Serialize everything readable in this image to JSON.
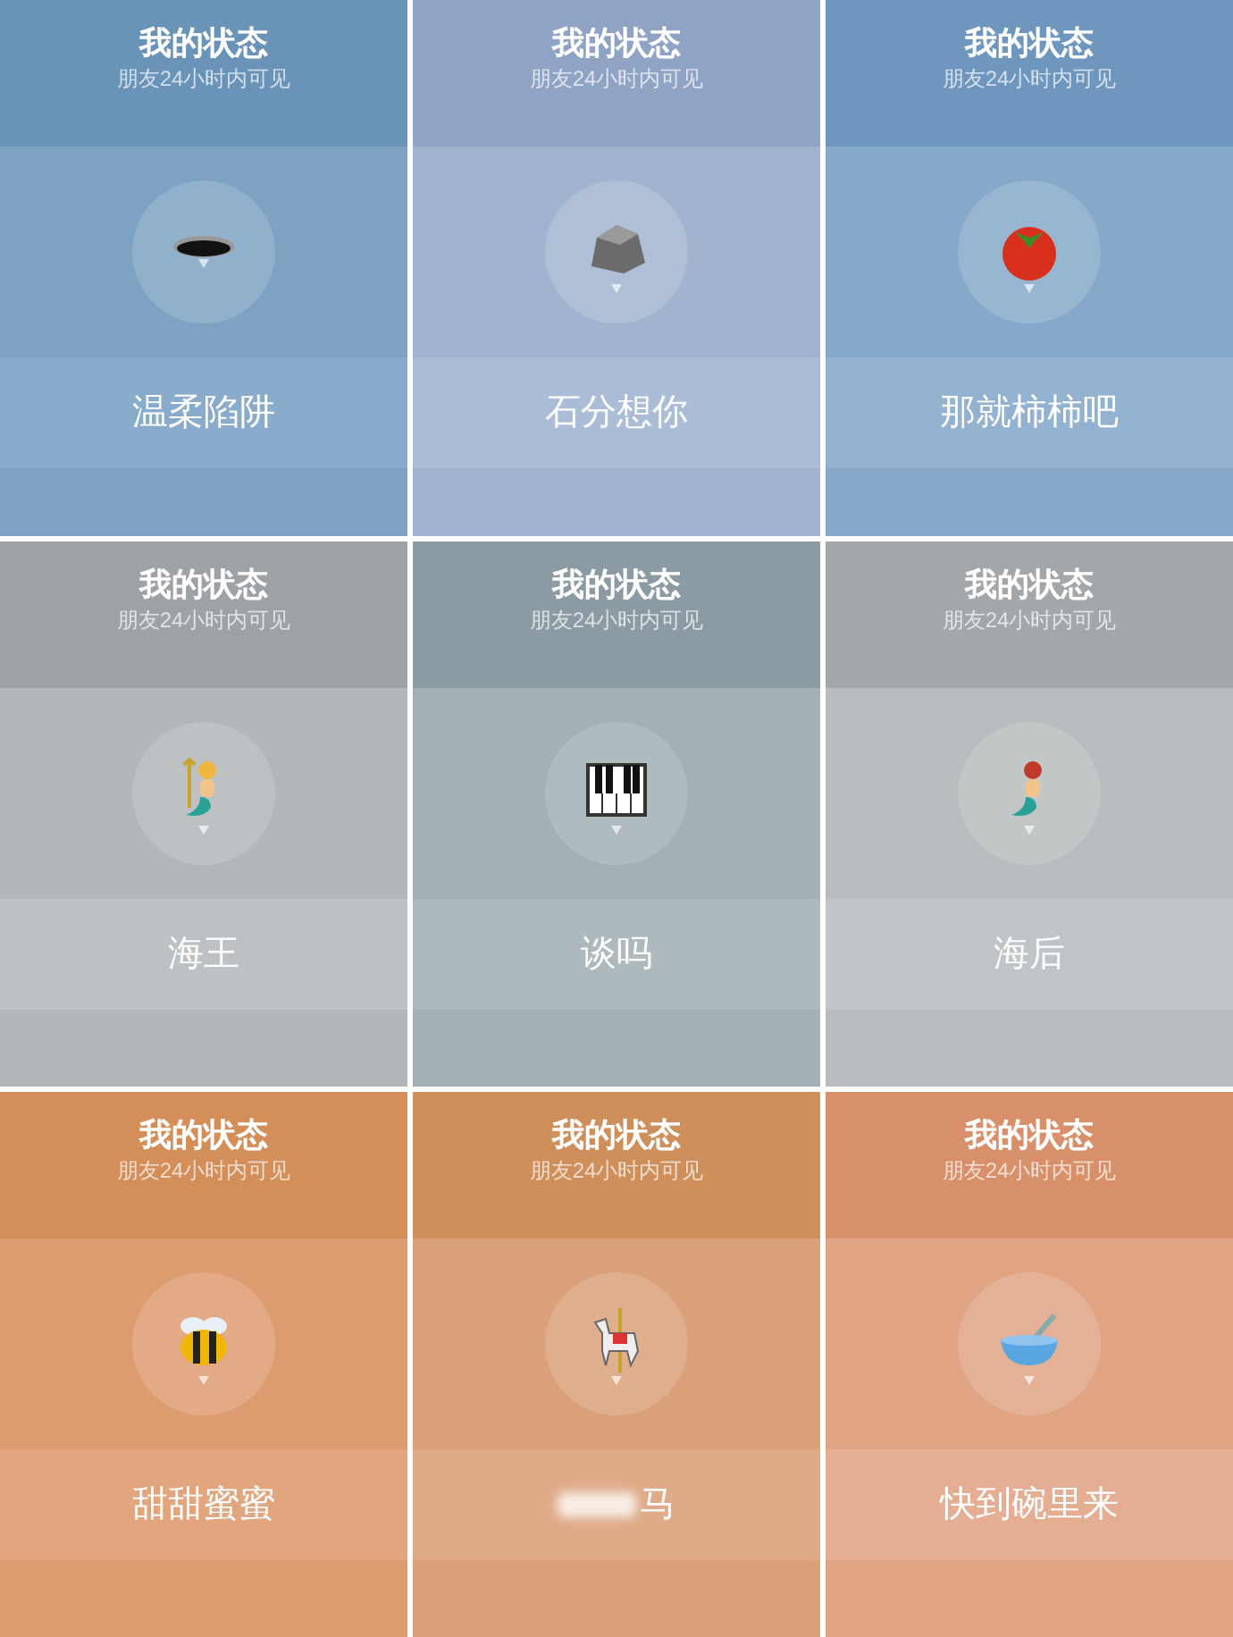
{
  "tiles": [
    {
      "title": "我的状态",
      "subtitle": "朋友24小时内可见",
      "kind": "hole",
      "status": "温柔陷阱"
    },
    {
      "title": "我的状态",
      "subtitle": "朋友24小时内可见",
      "kind": "rock",
      "status": "石分想你"
    },
    {
      "title": "我的状态",
      "subtitle": "朋友24小时内可见",
      "kind": "tomato",
      "status": "那就柿柿吧"
    },
    {
      "title": "我的状态",
      "subtitle": "朋友24小时内可见",
      "kind": "merman",
      "status": "海王"
    },
    {
      "title": "我的状态",
      "subtitle": "朋友24小时内可见",
      "kind": "piano",
      "status": "谈吗"
    },
    {
      "title": "我的状态",
      "subtitle": "朋友24小时内可见",
      "kind": "mermaid",
      "status": "海后"
    },
    {
      "title": "我的状态",
      "subtitle": "朋友24小时内可见",
      "kind": "bee",
      "status": "甜甜蜜蜜"
    },
    {
      "title": "我的状态",
      "subtitle": "朋友24小时内可见",
      "kind": "horse",
      "status": "马",
      "blurred": true
    },
    {
      "title": "我的状态",
      "subtitle": "朋友24小时内可见",
      "kind": "bowl",
      "status": "快到碗里来"
    }
  ]
}
